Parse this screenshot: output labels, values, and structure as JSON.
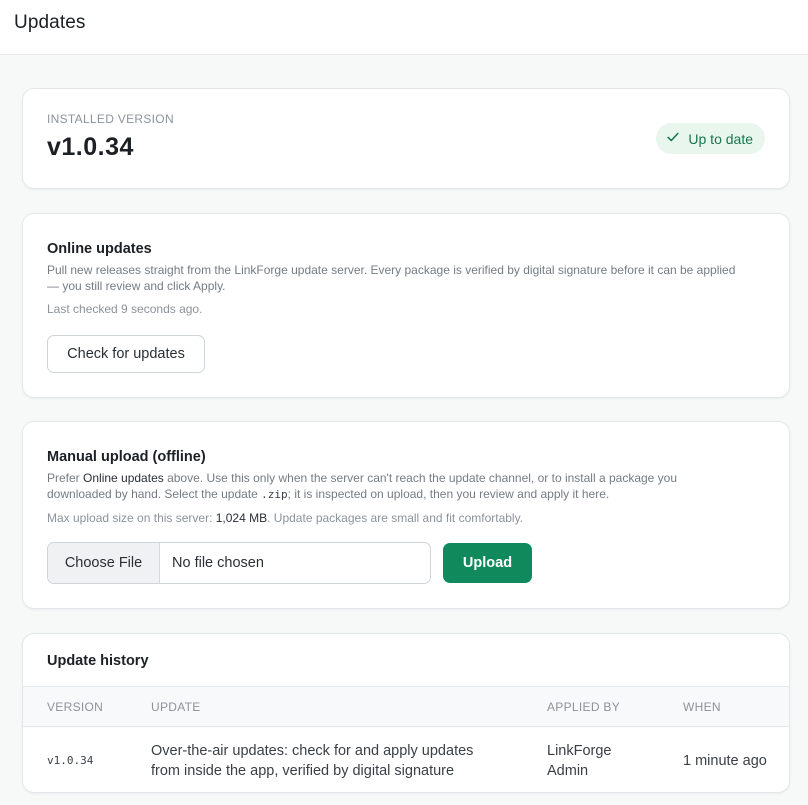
{
  "header": {
    "title": "Updates"
  },
  "installed": {
    "label": "INSTALLED VERSION",
    "version": "v1.0.34",
    "status": "Up to date",
    "status_color": "#15784c"
  },
  "online": {
    "title": "Online updates",
    "description": "Pull new releases straight from the LinkForge update server. Every package is verified by digital signature before it can be applied — you still review and click Apply.",
    "last_checked": "Last checked 9 seconds ago.",
    "check_button": "Check for updates"
  },
  "manual": {
    "title": "Manual upload (offline)",
    "desc_prefix": "Prefer ",
    "desc_link": "Online updates",
    "desc_mid": " above. Use this only when the server can't reach the update channel, or to install a package you downloaded by hand. Select the update ",
    "desc_ext": ".zip",
    "desc_suffix": "; it is inspected on upload, then you review and apply it here.",
    "max_prefix": "Max upload size on this server: ",
    "max_value": "1,024 MB",
    "max_suffix": ". Update packages are small and fit comfortably.",
    "choose_file": "Choose File",
    "no_file": "No file chosen",
    "upload_button": "Upload",
    "accent_color": "#108a5c"
  },
  "history": {
    "title": "Update history",
    "columns": [
      "VERSION",
      "UPDATE",
      "APPLIED BY",
      "WHEN"
    ],
    "rows": [
      {
        "version": "v1.0.34",
        "update_line1": "Over-the-air updates: check for and apply updates",
        "update_line2": "from inside the app, verified by digital signature",
        "applied_by_line1": "LinkForge",
        "applied_by_line2": "Admin",
        "when": "1 minute ago"
      }
    ]
  }
}
